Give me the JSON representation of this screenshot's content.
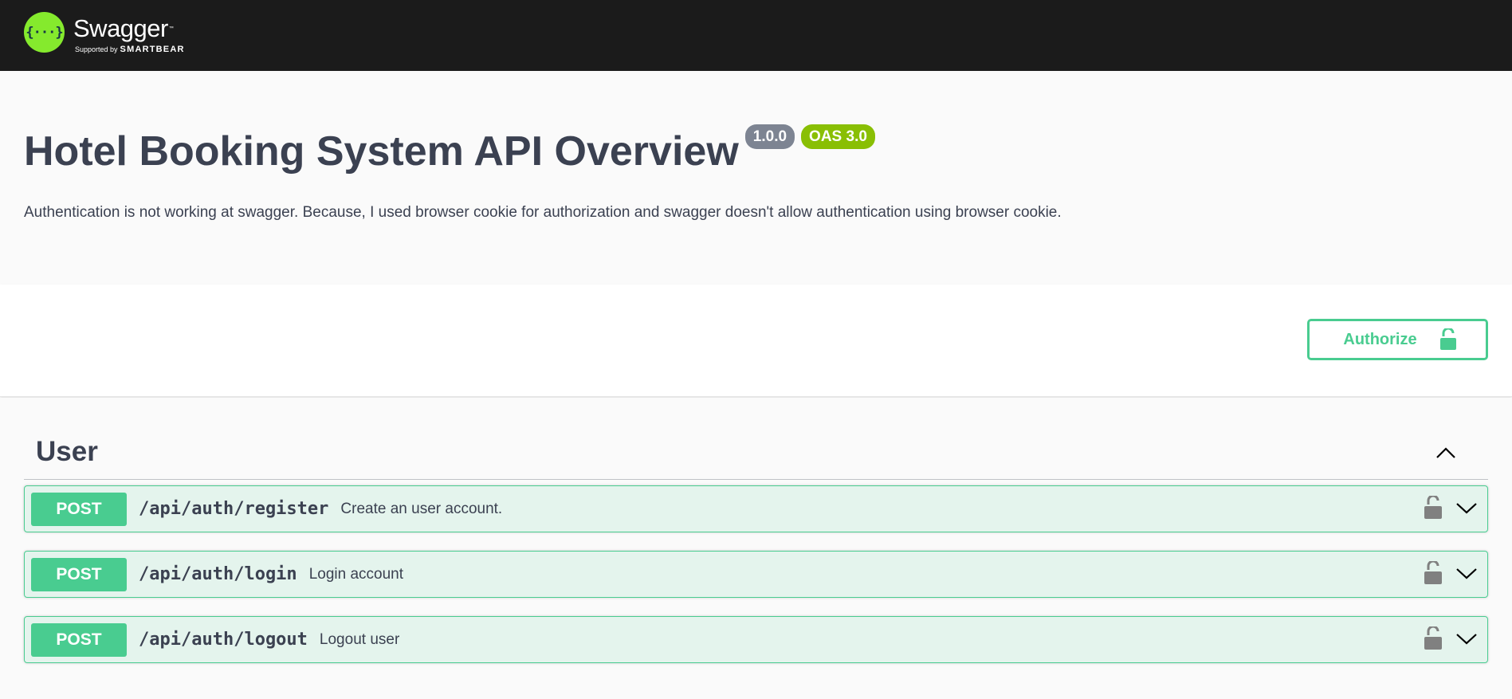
{
  "topbar": {
    "logo_name": "Swagger",
    "logo_tm": "™",
    "logo_supported": "Supported by",
    "logo_brand": "SMARTBEAR",
    "logo_glyph": "{···}"
  },
  "info": {
    "title": "Hotel Booking System API Overview",
    "version_badge": "1.0.0",
    "oas_badge": "OAS 3.0",
    "description": "Authentication is not working at swagger. Because, I used browser cookie for authorization and swagger doesn't allow authentication using browser cookie."
  },
  "schemes": {
    "authorize_label": "Authorize",
    "authorize_icon": "unlocked-padlock-icon"
  },
  "tag": {
    "name": "User",
    "toggle_icon": "chevron-up-icon",
    "operations": [
      {
        "method": "POST",
        "path": "/api/auth/register",
        "summary": "Create an user account."
      },
      {
        "method": "POST",
        "path": "/api/auth/login",
        "summary": "Login account"
      },
      {
        "method": "POST",
        "path": "/api/auth/logout",
        "summary": "Logout user"
      }
    ]
  },
  "colors": {
    "topbar_bg": "#1b1b1b",
    "logo_green": "#85ea2d",
    "post_green": "#49cc90",
    "version_badge_bg": "#7d8492",
    "oas_badge_bg": "#89bf04",
    "text": "#3b4151"
  }
}
